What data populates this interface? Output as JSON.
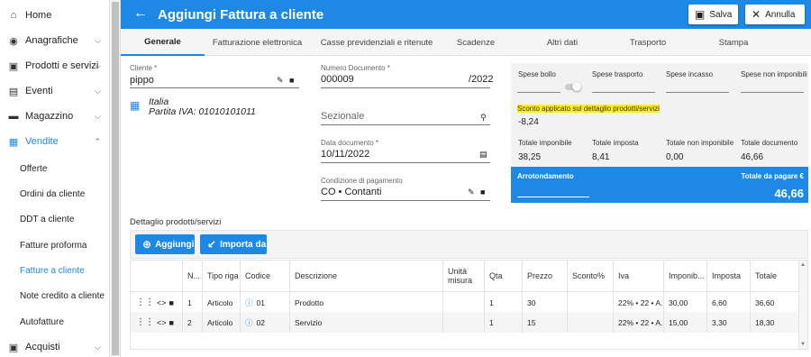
{
  "sidebar": {
    "items": [
      {
        "label": "Home",
        "icon": "home-icon",
        "glyph": "⌂"
      },
      {
        "label": "Anagrafiche",
        "icon": "people-icon",
        "glyph": "👥",
        "chevron": "⌄"
      },
      {
        "label": "Prodotti e servizi",
        "icon": "box-icon",
        "glyph": "▣",
        "chevron": "⌄"
      },
      {
        "label": "Eventi",
        "icon": "calendar-icon",
        "glyph": "▤",
        "chevron": "⌄"
      },
      {
        "label": "Magazzino",
        "icon": "warehouse-icon",
        "glyph": "▬",
        "chevron": "⌄"
      },
      {
        "label": "Vendite",
        "icon": "basket-icon",
        "glyph": "🧺",
        "chevron": "⌃"
      }
    ],
    "sub_items": [
      "Offerte",
      "Ordini da cliente",
      "DDT a cliente",
      "Fatture proforma",
      "Fatture a cliente",
      "Note credito a cliente",
      "Autofatture"
    ],
    "last_item": {
      "label": "Acquisti",
      "icon": "cart-icon",
      "glyph": "▣",
      "chevron": "⌄"
    }
  },
  "header": {
    "title": "Aggiungi Fattura a cliente",
    "save_label": "Salva",
    "cancel_label": "Annulla",
    "accent": "#1e88e5"
  },
  "tabs": [
    "Generale",
    "Fatturazione elettronica",
    "Casse previdenziali e ritenute",
    "Scadenze",
    "Altri dati",
    "Trasporto",
    "Stampa"
  ],
  "form": {
    "cliente_label": "Cliente *",
    "cliente_value": "pippo",
    "country": "Italia",
    "vat": "Partita IVA: 01010101011",
    "numero_label": "Numero Documento *",
    "numero_value": "000009",
    "numero_suffix": "/2022",
    "sezionale_placeholder": "Sezionale",
    "data_label": "Data documento *",
    "data_value": "10/11/2022",
    "pagamento_label": "Condizione di pagamento",
    "pagamento_value": "CO • Contanti"
  },
  "totals": {
    "spese_bollo": "Spese bollo",
    "spese_trasporto": "Spese trasporto",
    "spese_incasso": "Spese incasso",
    "spese_non_imponibili": "Spese non imponibili",
    "sconto_label": "Sconto applicato sul dettaglio prodotti/servizi",
    "sconto_value": "-8,24",
    "totale_imponibile_label": "Totale imponibile",
    "totale_imponibile": "38,25",
    "totale_imposta_label": "Totale imposta",
    "totale_imposta": "8,41",
    "totale_non_imponibile_label": "Totale non imponibile",
    "totale_non_imponibile": "0,00",
    "totale_documento_label": "Totale documento",
    "totale_documento": "46,66",
    "arrotondamento_label": "Arrotondamento",
    "totale_pagare_label": "Totale da pagare €",
    "totale_pagare": "46,66"
  },
  "detail": {
    "section_label": "Dettaglio prodotti/servizi",
    "add_label": "Aggiungi",
    "import_label": "Importa da",
    "columns": [
      "N...",
      "Tipo riga",
      "Codice",
      "Descrizione",
      "Unità misura",
      "Qta",
      "Prezzo",
      "Sconto%",
      "Iva",
      "Imponib...",
      "Imposta",
      "Totale"
    ],
    "rows": [
      {
        "n": "1",
        "tipo": "Articolo",
        "codice": "01",
        "descrizione": "Prodotto",
        "unita": "",
        "qta": "1",
        "prezzo": "30",
        "sconto": "",
        "iva": "22% • 22 • A...",
        "imponibile": "30,00",
        "imposta": "6,60",
        "totale": "36,60"
      },
      {
        "n": "2",
        "tipo": "Articolo",
        "codice": "02",
        "descrizione": "Servizio",
        "unita": "",
        "qta": "1",
        "prezzo": "15",
        "sconto": "",
        "iva": "22% • 22 • A...",
        "imponibile": "15,00",
        "imposta": "3,30",
        "totale": "18,30"
      }
    ]
  }
}
